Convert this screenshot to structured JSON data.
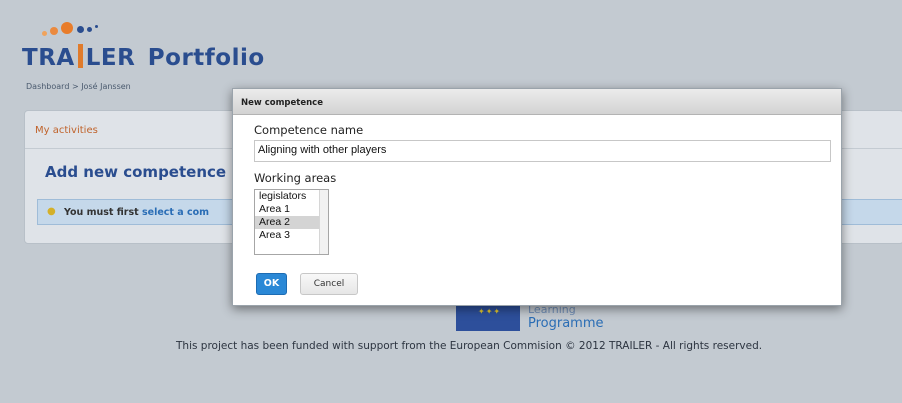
{
  "header": {
    "logo_main": "TRA",
    "logo_end": "LER",
    "logo_suffix": "Portfolio",
    "breadcrumb": "Dashboard >  José Janssen"
  },
  "card": {
    "tab_label": "My activities",
    "title": "Add new competence",
    "alert_prefix": "You must first ",
    "alert_link": "select a com"
  },
  "footer": {
    "learning": "Learning",
    "programme": "Programme",
    "text": "This project has been funded with support from the European Commision © 2012 TRAILER - All rights reserved."
  },
  "modal": {
    "title": "New competence",
    "name_label": "Competence name",
    "name_value": "Aligning with other players",
    "areas_label": "Working areas",
    "areas": [
      "legislators",
      "Area 1",
      "Area 2",
      "Area 3"
    ],
    "selected_area": "Area 2",
    "ok_label": "OK",
    "cancel_label": "Cancel"
  },
  "colors": {
    "accent_blue": "#2a4d8f",
    "ok_button": "#2a88d6",
    "tab_orange": "#c0632b"
  }
}
